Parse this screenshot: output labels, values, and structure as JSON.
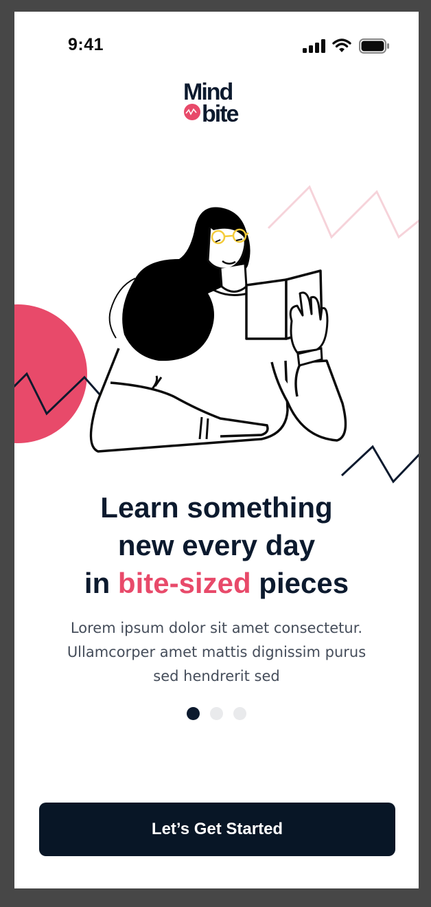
{
  "status_bar": {
    "time": "9:41",
    "icons": [
      "signal-icon",
      "wifi-icon",
      "battery-icon"
    ]
  },
  "logo": {
    "line1": "Mind",
    "line2": "bite"
  },
  "headline": {
    "line1": "Learn something",
    "line2": "new every day",
    "line3_prefix": "in ",
    "line3_accent": "bite-sized",
    "line3_suffix": " pieces"
  },
  "description": "Lorem ipsum dolor sit amet consectetur. Ullamcorper amet mattis dignissim purus sed hendrerit sed",
  "pager": {
    "current": 1,
    "total": 3
  },
  "cta": {
    "label": "Let’s Get Started"
  },
  "colors": {
    "accent": "#e84a6a",
    "navy": "#0c1a2e",
    "button": "#081626",
    "frame": "#474747"
  },
  "illustration": {
    "subject": "woman-reading-book-illustration"
  }
}
